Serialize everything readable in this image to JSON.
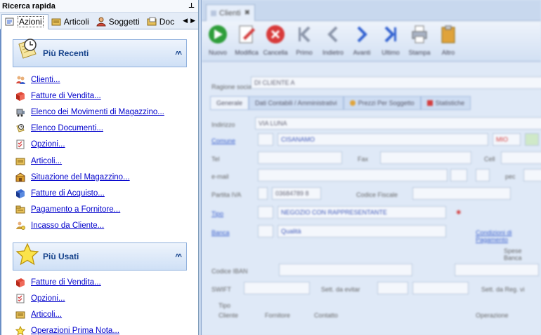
{
  "panel": {
    "title": "Ricerca rapida",
    "pin_glyph": "⊥"
  },
  "tabs": [
    {
      "label": "Azioni",
      "icon": "actions-icon",
      "active": true
    },
    {
      "label": "Articoli",
      "icon": "articles-icon",
      "active": false
    },
    {
      "label": "Soggetti",
      "icon": "subjects-icon",
      "active": false
    },
    {
      "label": "Doc",
      "icon": "documents-icon",
      "active": false
    }
  ],
  "groups": {
    "recent": {
      "title": "Più Recenti",
      "icon": "clock-icon",
      "items": [
        {
          "label": "Clienti...",
          "icon": "clients-icon"
        },
        {
          "label": "Fatture di Vendita...",
          "icon": "sales-invoice-icon"
        },
        {
          "label": "Elenco dei Movimenti di Magazzino...",
          "icon": "warehouse-movements-icon"
        },
        {
          "label": "Elenco Documenti...",
          "icon": "documents-list-icon"
        },
        {
          "label": "Opzioni...",
          "icon": "options-icon"
        },
        {
          "label": "Articoli...",
          "icon": "articles-icon"
        },
        {
          "label": "Situazione del Magazzino...",
          "icon": "warehouse-status-icon"
        },
        {
          "label": "Fatture di Acquisto...",
          "icon": "purchase-invoice-icon"
        },
        {
          "label": "Pagamento a Fornitore...",
          "icon": "supplier-payment-icon"
        },
        {
          "label": "Incasso da Cliente...",
          "icon": "client-collection-icon"
        }
      ]
    },
    "used": {
      "title": "Più Usati",
      "icon": "star-icon",
      "items": [
        {
          "label": "Fatture di Vendita...",
          "icon": "sales-invoice-icon"
        },
        {
          "label": "Opzioni...",
          "icon": "options-icon"
        },
        {
          "label": "Articoli...",
          "icon": "articles-icon"
        },
        {
          "label": "Operazioni Prima Nota...",
          "icon": "star-small-icon"
        }
      ]
    }
  },
  "right": {
    "doc_tab": "Clienti",
    "toolbar": [
      {
        "label": "Nuovo",
        "icon": "new-icon",
        "color": "#2e9e3a"
      },
      {
        "label": "Modifica",
        "icon": "edit-icon",
        "color": "#7a7a7a"
      },
      {
        "label": "Cancella",
        "icon": "delete-icon",
        "color": "#d83a3a"
      },
      {
        "label": "Primo",
        "icon": "first-icon",
        "color": "#8a94a8"
      },
      {
        "label": "Indietro",
        "icon": "back-icon",
        "color": "#8a94a8"
      },
      {
        "label": "Avanti",
        "icon": "forward-icon",
        "color": "#2f5fd0"
      },
      {
        "label": "Ultimo",
        "icon": "last-icon",
        "color": "#2f5fd0"
      },
      {
        "label": "Stampa",
        "icon": "print-icon",
        "color": "#8a94a8"
      },
      {
        "label": "Altro",
        "icon": "clipboard-icon",
        "color": "#e0a33a"
      }
    ],
    "form": {
      "ragione_label": "Ragione sociale",
      "ragione_value": "DI CLIENTE A",
      "subtabs": [
        "Generale",
        "Dati Contabili / Amministrativi",
        "Prezzi Per Soggetto",
        "Statistiche"
      ],
      "indirizzo_label": "Indirizzo",
      "indirizzo_value": "VIA LUNA",
      "comune_label": "Comune",
      "comune_value": "CISANAMO",
      "comune_extra": "MIO",
      "tel_label": "Tel",
      "fax_label": "Fax",
      "cell_label": "Cell",
      "email_label": "e-mail",
      "pec_label": "pec",
      "piva_label": "Partita IVA",
      "piva_value": "03684789 8",
      "cf_label": "Codice Fiscale",
      "tipo_label": "Tipo",
      "tipo_value": "NEGOZIO CON RAPPRESENTANTE",
      "banca_label": "Banca",
      "banca_value": "Qualità",
      "condizioni": "Condizioni di Pagamento",
      "spese": "Spese Banca",
      "iban_label": "Codice IBAN",
      "swift_label": "SWIFT",
      "sett_label": "Sett. da evitar",
      "sett2_label": "Sett. da Reg. vi",
      "tipo2_label": "Tipo",
      "chk1": "Cliente",
      "chk2": "Fornitore",
      "chk3": "Contatto",
      "chk4": "Operazione"
    }
  }
}
